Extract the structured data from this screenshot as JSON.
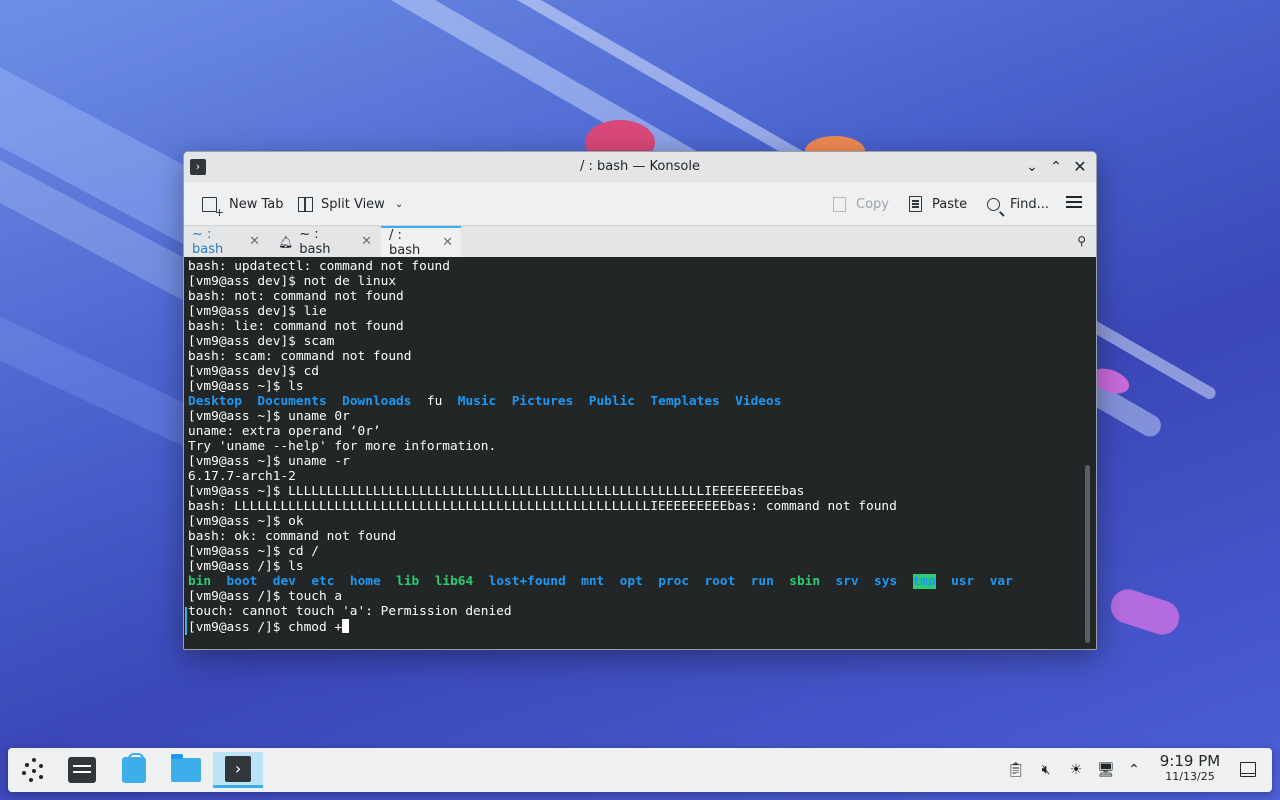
{
  "window": {
    "title": "/ : bash — Konsole",
    "app_icon": "konsole-icon",
    "controls": {
      "minimize": "chevron-down-icon",
      "maximize": "chevron-up-icon",
      "close": "close-icon"
    }
  },
  "toolbar": {
    "new_tab": "New Tab",
    "split_view": "Split View",
    "copy": "Copy",
    "paste": "Paste",
    "find": "Find...",
    "menu_icon": "hamburger-icon"
  },
  "tabs": [
    {
      "label": "~ : bash",
      "active": false,
      "bell": false
    },
    {
      "label": "~ : bash",
      "active": false,
      "bell": true
    },
    {
      "label": "/ : bash",
      "active": true,
      "bell": false
    }
  ],
  "terminal": {
    "lines": [
      "bash: updatectl: command not found",
      "[vm9@ass dev]$ not de linux",
      "bash: not: command not found",
      "[vm9@ass dev]$ lie",
      "bash: lie: command not found",
      "[vm9@ass dev]$ scam",
      "bash: scam: command not found",
      "[vm9@ass dev]$ cd",
      "[vm9@ass ~]$ ls"
    ],
    "home_ls": [
      "Desktop",
      "Documents",
      "Downloads",
      "fu",
      "Music",
      "Pictures",
      "Public",
      "Templates",
      "Videos"
    ],
    "lines2": [
      "[vm9@ass ~]$ uname 0r",
      "uname: extra operand ‘0r’",
      "Try 'uname --help' for more information.",
      "[vm9@ass ~]$ uname -r",
      "6.17.7-arch1-2",
      "[vm9@ass ~]$ LLLLLLLLLLLLLLLLLLLLLLLLLLLLLLLLLLLLLLLLLLLLLLLLLLLLLLIEEEEEEEEEbas",
      "bash: LLLLLLLLLLLLLLLLLLLLLLLLLLLLLLLLLLLLLLLLLLLLLLLLLLLLLLIEEEEEEEEEbas: command not found",
      "[vm9@ass ~]$ ok",
      "bash: ok: command not found",
      "[vm9@ass ~]$ cd /",
      "[vm9@ass /]$ ls"
    ],
    "root_ls": [
      "bin",
      "boot",
      "dev",
      "etc",
      "home",
      "lib",
      "lib64",
      "lost+found",
      "mnt",
      "opt",
      "proc",
      "root",
      "run",
      "sbin",
      "srv",
      "sys",
      "tmp",
      "usr",
      "var"
    ],
    "lines3": [
      "[vm9@ass /]$ touch a",
      "touch: cannot touch 'a': Permission denied"
    ],
    "prompt": "[vm9@ass /]$ chmod +"
  },
  "taskbar": {
    "apps": [
      "application-launcher-icon",
      "system-settings-icon",
      "discover-icon",
      "dolphin-folder-icon",
      "konsole-icon"
    ],
    "tray": [
      "clipboard-icon",
      "volume-muted-icon",
      "brightness-icon",
      "network-icon",
      "chevron-up-icon"
    ],
    "time": "9:19 PM",
    "date": "11/13/25"
  }
}
